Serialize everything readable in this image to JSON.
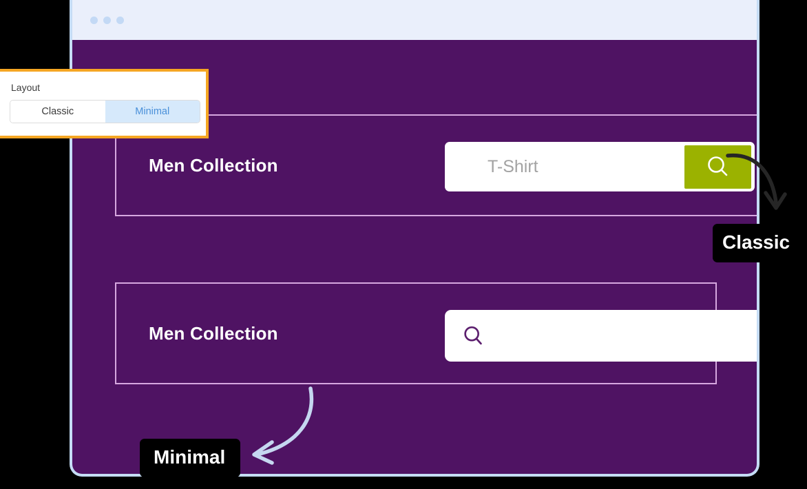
{
  "window": {
    "dots": [
      "dot-1",
      "dot-2",
      "dot-3"
    ]
  },
  "previews": [
    {
      "variant": "classic",
      "title": "Men Collection",
      "search_placeholder": "T-Shirt",
      "search_button_icon": "search-icon",
      "search_button_color": "#9bb200"
    },
    {
      "variant": "minimal",
      "title": "Men Collection",
      "search_placeholder": "",
      "search_icon": "search-icon",
      "search_icon_color": "#5c1f6e"
    }
  ],
  "callouts": [
    {
      "label": "Classic",
      "arrow": "curved-arrow-down-right"
    },
    {
      "label": "Minimal",
      "arrow": "curved-arrow-left"
    }
  ],
  "layout_popover": {
    "label": "Layout",
    "options": [
      {
        "label": "Classic",
        "selected": false
      },
      {
        "label": "Minimal",
        "selected": true
      }
    ],
    "border_color": "#f5a623",
    "selected_bg": "#d6e9fb",
    "selected_fg": "#4a90d9"
  },
  "colors": {
    "page_background": "#4f1363",
    "window_chrome": "#eaeffb",
    "window_border": "#c5dcf5",
    "card_border": "#d7a8e0",
    "callout_background": "#000000"
  }
}
